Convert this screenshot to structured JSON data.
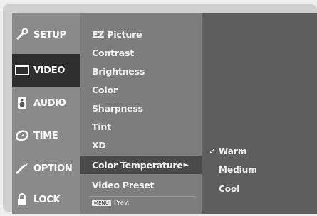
{
  "sidebar": {
    "items": [
      {
        "label": "SETUP",
        "icon": "setup-icon"
      },
      {
        "label": "VIDEO",
        "icon": "video-icon"
      },
      {
        "label": "AUDIO",
        "icon": "audio-icon"
      },
      {
        "label": "TIME",
        "icon": "time-icon"
      },
      {
        "label": "OPTION",
        "icon": "option-icon"
      },
      {
        "label": "LOCK",
        "icon": "lock-icon"
      }
    ],
    "active": "VIDEO"
  },
  "menu": {
    "items": [
      "EZ Picture",
      "Contrast",
      "Brightness",
      "Color",
      "Sharpness",
      "Tint",
      "XD",
      "Color Temperature",
      "Video Preset"
    ],
    "selected": "Color Temperature",
    "selected_arrow": "►"
  },
  "hint": {
    "key": "MENU",
    "label": "Prev."
  },
  "submenu": {
    "items": [
      {
        "label": "Warm",
        "checked": true
      },
      {
        "label": "Medium",
        "checked": false
      },
      {
        "label": "Cool",
        "checked": false
      }
    ],
    "check_glyph": "✓"
  }
}
